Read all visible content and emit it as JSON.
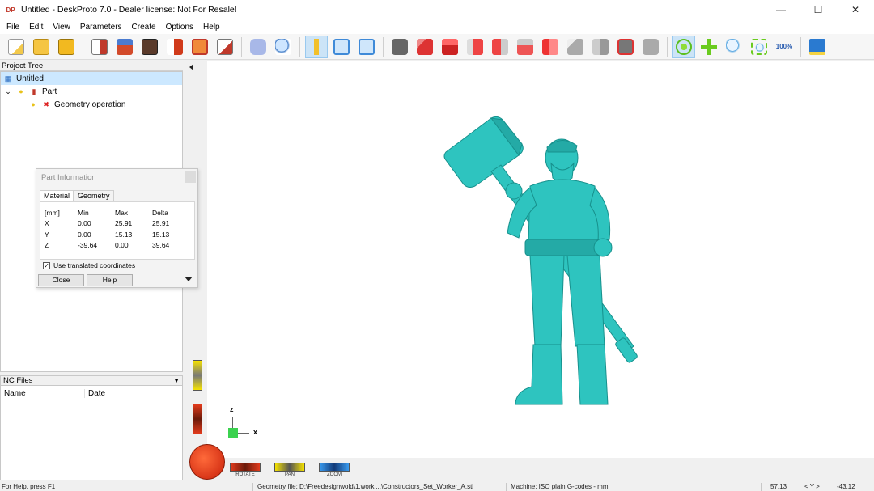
{
  "window": {
    "icon_text": "DP",
    "title": "Untitled - DeskProto 7.0 - Dealer license: Not For Resale!",
    "controls": [
      "—",
      "☐",
      "✕"
    ]
  },
  "menu": [
    "File",
    "Edit",
    "View",
    "Parameters",
    "Create",
    "Options",
    "Help"
  ],
  "toolbar": {
    "zoom_text": "100%"
  },
  "project_tree": {
    "header": "Project Tree",
    "root": "Untitled",
    "part": "Part",
    "operation": "Geometry operation"
  },
  "nc_files": {
    "header": "NC Files",
    "col_name": "Name",
    "col_date": "Date"
  },
  "part_info": {
    "title": "Part Information",
    "tab_material": "Material",
    "tab_geometry": "Geometry",
    "header": [
      "[mm]",
      "Min",
      "Max",
      "Delta"
    ],
    "rows": [
      [
        "X",
        "0.00",
        "25.91",
        "25.91"
      ],
      [
        "Y",
        "0.00",
        "15.13",
        "15.13"
      ],
      [
        "Z",
        "-39.64",
        "0.00",
        "39.64"
      ]
    ],
    "checkbox_label": "Use translated coordinates",
    "checkbox_checked": true,
    "close_label": "Close",
    "help_label": "Help"
  },
  "viewport": {
    "model_color": "#2ec4bf",
    "axis_z": "z",
    "axis_x": "x",
    "wheel_rotate": "ROTATE",
    "wheel_pan": "PAN",
    "wheel_zoom": "ZOOM"
  },
  "status": {
    "help": "For Help, press F1",
    "geometry": "Geometry file: D:\\Freedesignwold\\1.worki...\\Constructors_Set_Worker_A.stl",
    "machine": "Machine: ISO plain G-codes - mm",
    "coord_x": "57.13",
    "coord_label": "< Y >",
    "coord_y": "-43.12"
  }
}
